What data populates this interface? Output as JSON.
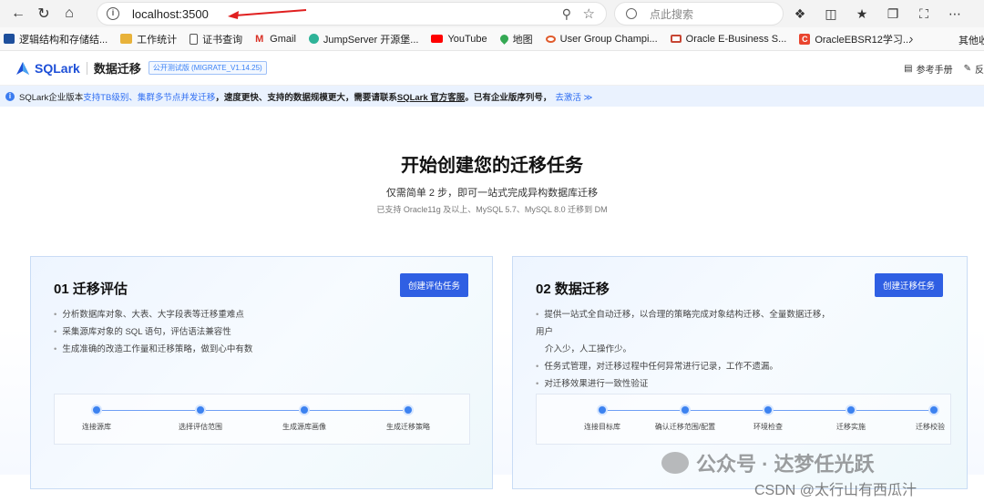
{
  "browser": {
    "url": "localhost:3500",
    "search_placeholder": "点此搜索"
  },
  "bookmarks": [
    {
      "label": "逻辑结构和存储结...",
      "icon": "site-logo-icon"
    },
    {
      "label": "工作统计",
      "icon": "folder-icon"
    },
    {
      "label": "证书查询",
      "icon": "document-icon"
    },
    {
      "label": "Gmail",
      "icon": "gmail-icon"
    },
    {
      "label": "JumpServer 开源堡...",
      "icon": "jumpserver-icon"
    },
    {
      "label": "YouTube",
      "icon": "youtube-icon"
    },
    {
      "label": "地图",
      "icon": "map-icon"
    },
    {
      "label": "User Group Champi...",
      "icon": "user-group-icon"
    },
    {
      "label": "Oracle E-Business S...",
      "icon": "oracle-icon"
    },
    {
      "label": "OracleEBSR12学习...",
      "icon": "csdn-icon"
    }
  ],
  "bookmarks_other": "其他收",
  "app": {
    "logo_text": "SQLark",
    "title": "数据迁移",
    "version": "公开测试版 (MIGRATE_V1.14.25)",
    "header_links": [
      "参考手册",
      "反"
    ]
  },
  "notice": {
    "prefix": "SQLark企业版本",
    "highlight": "支持TB级别、集群多节点并发迁移",
    "middle": "，速度更快、支持的数据规模更大，需要请联系",
    "contact": "SQLark 官方客服",
    "suffix": "。已有企业版序列号，",
    "link": "去激活 ≫"
  },
  "hero": {
    "title": "开始创建您的迁移任务",
    "subtitle": "仅需简单 2 步，即可一站式完成异构数据库迁移",
    "support": "已支持 Oracle11g 及以上、MySQL 5.7、MySQL 8.0 迁移到 DM"
  },
  "cards": [
    {
      "title": "01 迁移评估",
      "button": "创建评估任务",
      "bullets": [
        "分析数据库对象、大表、大字段表等迁移重难点",
        "采集源库对象的 SQL 语句，评估语法兼容性",
        "生成准确的改造工作量和迁移策略，做到心中有数"
      ],
      "steps": [
        "连接源库",
        "选择评估范围",
        "生成源库画像",
        "生成迁移策略"
      ]
    },
    {
      "title": "02 数据迁移",
      "button": "创建迁移任务",
      "bullets": [
        "提供一站式全自动迁移，以合理的策略完成对象结构迁移、全量数据迁移，用户",
        "介入少，人工操作少。",
        "任务式管理，对迁移过程中任何异常进行记录，工作不遗漏。",
        "对迁移效果进行一致性验证"
      ],
      "steps": [
        "连接目标库",
        "确认迁移范围/配置",
        "环境检查",
        "迁移实施",
        "迁移校验"
      ]
    }
  ],
  "watermark": {
    "line1": "公众号 · 达梦任光跃",
    "line2": "CSDN @太行山有西瓜汁"
  }
}
